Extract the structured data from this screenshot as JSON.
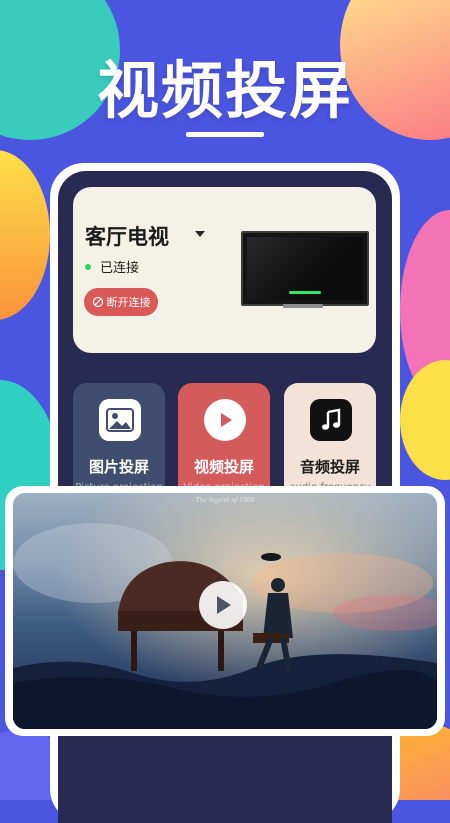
{
  "headline": "视频投屏",
  "device": {
    "name": "客厅电视",
    "status": "已连接",
    "disconnect_label": "断开连接"
  },
  "features": [
    {
      "label": "图片投屏",
      "sub": "Picture projection",
      "icon": "image-icon",
      "bg": "#3f4d6e",
      "fg": "#ffffff"
    },
    {
      "label": "视频投屏",
      "sub": "Video projection",
      "icon": "play-circle-icon",
      "bg": "#d35b5b",
      "fg": "#ffffff"
    },
    {
      "label": "音频投屏",
      "sub": "audio frequency",
      "icon": "music-note-icon",
      "bg": "#f2e2d8",
      "fg": "#1b1b1b"
    }
  ],
  "video": {
    "caption": "The legend of 1900"
  },
  "colors": {
    "background": "#4a55e0",
    "accent_red": "#d95858",
    "status_green": "#2fd35b"
  }
}
